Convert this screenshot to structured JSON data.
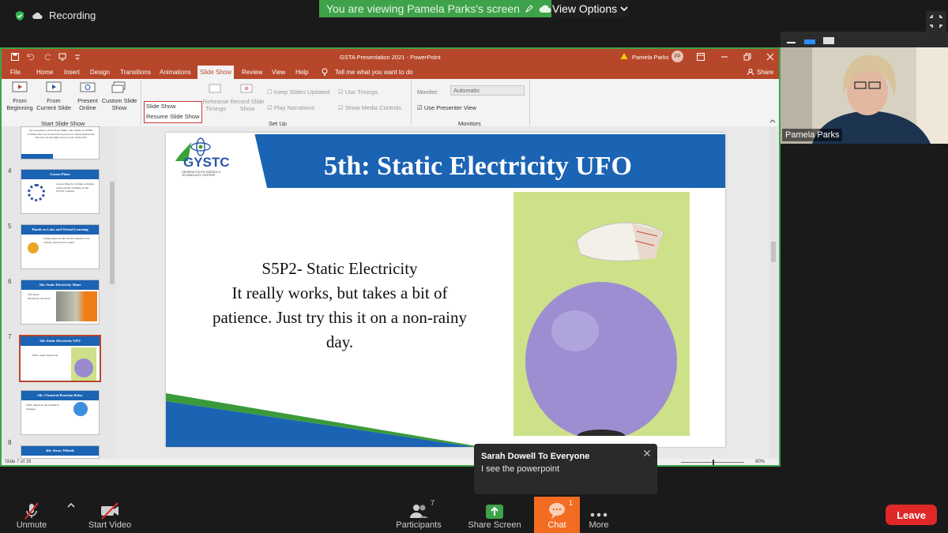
{
  "top": {
    "recording_label": "Recording",
    "viewing_banner": "You are viewing Pamela Parks's screen",
    "view_options": "View Options"
  },
  "ppt": {
    "window_title": "GSTA Presentation 2021 - PowerPoint",
    "user_name": "Pamela Parks",
    "user_initials": "PP",
    "menu": [
      "File",
      "Home",
      "Insert",
      "Design",
      "Transitions",
      "Animations",
      "Slide Show",
      "Review",
      "View",
      "Help"
    ],
    "active_tab": "Slide Show",
    "tell_me": "Tell me what you want to do",
    "share_label": "Share",
    "ribbon": {
      "from_beginning": "From Beginning",
      "from_current": "From Current Slide",
      "present_online": "Present Online",
      "custom_slide_show": "Custom Slide Show",
      "group_start": "Start Slide Show",
      "slide_show_dropdown": "Slide Show",
      "resume_slide_show": "Resume Slide Show",
      "rehearse_timings": "Rehearse Timings",
      "record_slide_show": "Record Slide Show",
      "keep_slides_updated": "Keep Slides Updated",
      "play_narrations": "Play Narrations",
      "use_timings": "Use Timings",
      "show_media_controls": "Show Media Controls",
      "group_setup": "Set Up",
      "monitor_label": "Monitor:",
      "monitor_value": "Automatic",
      "use_presenter_view": "Use Presenter View",
      "group_monitors": "Monitors"
    },
    "status_slide": "Slide 7 of 16",
    "zoom_level": "80%"
  },
  "thumbnails": [
    {
      "num": "",
      "title": "",
      "body": "We are going to learn about simple, fun, hands-on STEM activities that can be used for in-person or virtual instruction that you can use right away in your classroom!"
    },
    {
      "num": "4",
      "title": "Lesson Plans",
      "body": "Lesson Plans for all nine activities will be made available on the GYSTC website."
    },
    {
      "num": "5",
      "title": "Hands on Labs and Virtual Learning",
      "body": "Using hands-on labs allows students to be actively involved in content."
    },
    {
      "num": "6",
      "title": "5th: Static Electricity Slime",
      "body": "5P2-Static Electricity and Trees"
    },
    {
      "num": "7",
      "title": "5th: Static Electricity UFO",
      "body": "S5P2- Static Electricity"
    },
    {
      "num": "8",
      "title": "5th: Chemical Reaction Relay",
      "body": "S5P2- Physical and Chemical Changes"
    },
    {
      "num": "9",
      "title": "4th: Straw Whistle",
      "body": ""
    }
  ],
  "slide": {
    "logo_text": "GYSTC",
    "logo_sub": "GEORGIA YOUTH SCIENCE & TECHNOLOGY CENTERS",
    "title": "5th: Static Electricity UFO",
    "body_line1": "S5P2- Static Electricity",
    "body_line2": "It really works, but takes a bit of patience. Just try this it on a non-rainy day."
  },
  "video": {
    "participant_name": "Pamela Parks"
  },
  "chat": {
    "header": "Sarah Dowell To Everyone",
    "message": "I see the powerpoint"
  },
  "toolbar": {
    "unmute": "Unmute",
    "start_video": "Start Video",
    "participants": "Participants",
    "participants_count": "7",
    "share_screen": "Share Screen",
    "chat": "Chat",
    "chat_count": "1",
    "more": "More",
    "leave": "Leave"
  },
  "colors": {
    "zoom_green": "#3ea24a",
    "ppt_red": "#b7472a",
    "slide_blue": "#1b63b3",
    "leave_red": "#e02828",
    "chat_orange": "#f26d21"
  }
}
